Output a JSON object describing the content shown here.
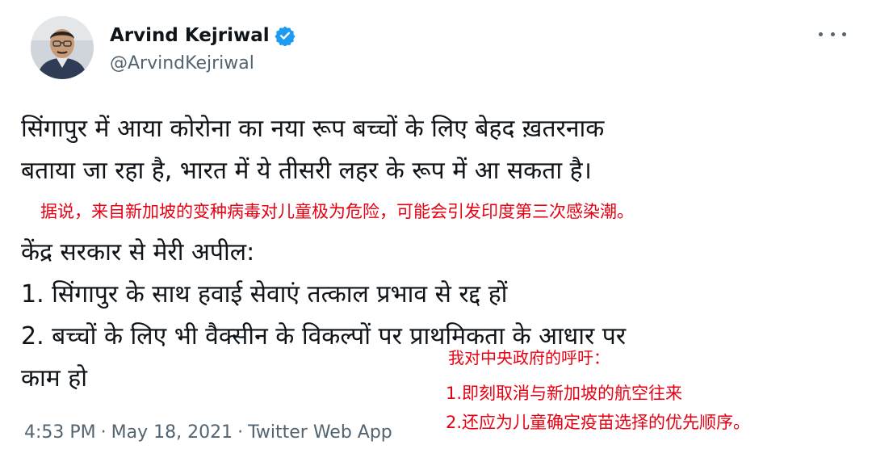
{
  "header": {
    "display_name": "Arvind Kejriwal",
    "handle": "@ArvindKejriwal",
    "verified_icon": "verified-badge-icon",
    "more_icon": "more-options-icon",
    "accent_color": "#1d9bf0"
  },
  "tweet": {
    "line1": "सिंगापुर में आया कोरोना का नया रूप बच्चों के लिए बेहद ख़तरनाक",
    "line2": "बताया जा रहा है, भारत में ये तीसरी लहर के रूप में आ सकता है।",
    "line3": "केंद्र सरकार से मेरी अपील:",
    "line4": "1. सिंगापुर के साथ हवाई सेवाएं तत्काल प्रभाव से रद्द हों",
    "line5": "2. बच्चों के लिए भी वैक्सीन के विकल्पों पर प्राथमिकता के आधार पर",
    "line6": "काम हो"
  },
  "annotations": {
    "translation1": "据说，来自新加坡的变种病毒对儿童极为危险，可能会引发印度第三次感染潮。",
    "translation2_line1": "我对中央政府的呼吁：",
    "translation2_line2": "1.即刻取消与新加坡的航空往来",
    "translation2_line3": "2.还应为儿童确定疫苗选择的优先顺序。",
    "color": "#e60012"
  },
  "meta": {
    "time": "4:53 PM",
    "separator": "·",
    "date": "May 18, 2021",
    "source": "Twitter Web App"
  }
}
